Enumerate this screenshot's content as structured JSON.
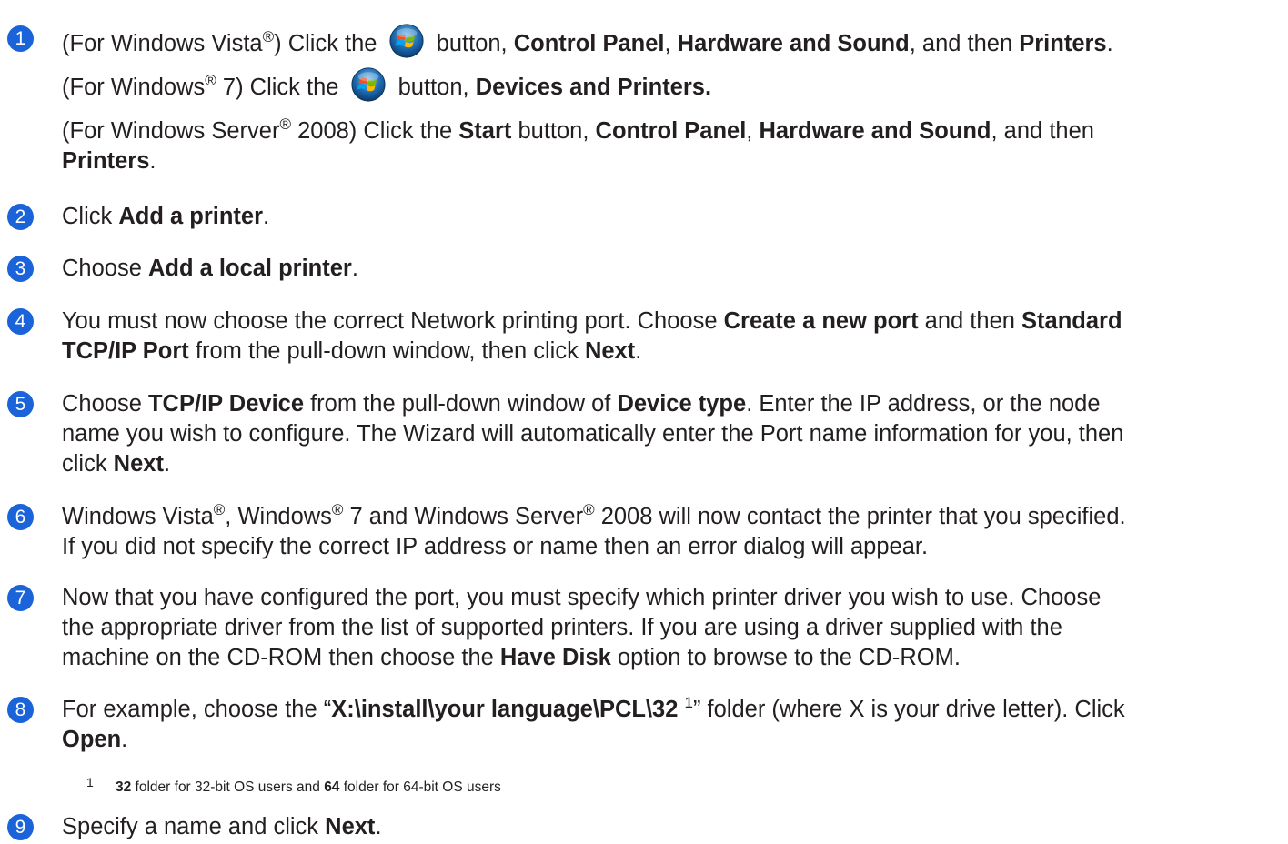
{
  "steps": [
    {
      "num": "1",
      "l1": {
        "a": "(For Windows Vista",
        "reg": "®",
        "b": ") Click the ",
        "c": " button, ",
        "d": "Control Panel",
        "e": ", ",
        "f": "Hardware and Sound",
        "g": ", and then ",
        "h": "Printers",
        "i": "."
      },
      "l2": {
        "a": "(For Windows",
        "reg": "®",
        "b": " 7) Click the ",
        "c": " button, ",
        "d": "Devices and Printers."
      },
      "l3": {
        "a": "(For Windows Server",
        "reg": "®",
        "b": " 2008) Click the ",
        "c": "Start",
        "d": " button, ",
        "e": "Control Panel",
        "f": ", ",
        "g": "Hardware and Sound",
        "h": ", and then"
      },
      "l4": {
        "a": "Printers",
        "b": "."
      }
    },
    {
      "num": "2",
      "a": "Click ",
      "b": "Add a printer",
      "c": "."
    },
    {
      "num": "3",
      "a": "Choose ",
      "b": "Add a local printer",
      "c": "."
    },
    {
      "num": "4",
      "l1": {
        "a": "You must now choose the correct Network printing port. Choose ",
        "b": "Create a new port",
        "c": " and then ",
        "d": "Standard"
      },
      "l2": {
        "a": "TCP/IP Port",
        "b": " from the pull-down window, then click ",
        "c": "Next",
        "d": "."
      }
    },
    {
      "num": "5",
      "l1": {
        "a": "Choose ",
        "b": "TCP/IP Device",
        "c": " from the pull-down window of ",
        "d": "Device type",
        "e": ". Enter the IP address, or the node"
      },
      "l2": "name you wish to configure. The Wizard will automatically enter the Port name information for you, then",
      "l3": {
        "a": "click ",
        "b": "Next",
        "c": "."
      }
    },
    {
      "num": "6",
      "l1": {
        "a": "Windows Vista",
        "reg1": "®",
        "b": ", Windows",
        "reg2": "®",
        "c": " 7 and Windows Server",
        "reg3": "®",
        "d": " 2008 will now contact the printer that you specified."
      },
      "l2": "If you did not specify the correct IP address or name then an error dialog will appear."
    },
    {
      "num": "7",
      "l1": "Now that you have configured the port, you must specify which printer driver you wish to use. Choose",
      "l2": "the appropriate driver from the list of supported printers. If you are using a driver supplied with the",
      "l3": {
        "a": "machine on the CD-ROM then choose the ",
        "b": "Have Disk",
        "c": " option to browse to the CD-ROM."
      }
    },
    {
      "num": "8",
      "l1": {
        "a": "For example, choose the “",
        "b": "X:\\install\\your language\\PCL\\32",
        "c": "1",
        "d": "” folder (where X is your drive letter). Click"
      },
      "l2": {
        "a": "Open",
        "b": "."
      }
    },
    {
      "num": "9",
      "a": "Specify a name and click ",
      "b": "Next",
      "c": "."
    }
  ],
  "footnote": {
    "num": "1",
    "a": "32",
    "b": " folder for 32-bit OS users and ",
    "c": "64",
    "d": " folder for 64-bit OS users"
  },
  "icons": {
    "windows_start_button": "windows-start-orb-icon"
  },
  "colors": {
    "badge": "#1a63d8",
    "text": "#231f20"
  }
}
